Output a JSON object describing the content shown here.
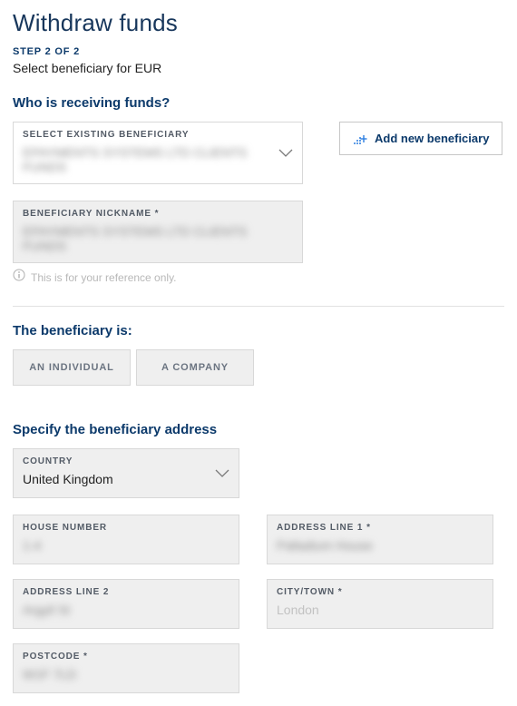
{
  "page": {
    "title": "Withdraw funds",
    "step": "STEP 2 OF 2",
    "subtitle": "Select beneficiary for EUR"
  },
  "receiving": {
    "heading": "Who is receiving funds?",
    "select_label": "SELECT EXISTING BENEFICIARY",
    "select_value_masked": "EPAYMENTS SYSTEMS LTD CLIENTS FUNDS",
    "add_button": "Add new beneficiary",
    "nickname_label": "BENEFICIARY NICKNAME *",
    "nickname_value_masked": "EPAYMENTS SYSTEMS LTD CLIENTS FUNDS",
    "helper": "This is for your reference only."
  },
  "beneficiary_type": {
    "heading": "The beneficiary is:",
    "individual": "AN INDIVIDUAL",
    "company": "A COMPANY"
  },
  "address": {
    "heading": "Specify the beneficiary address",
    "country_label": "COUNTRY",
    "country_value": "United Kingdom",
    "house_label": "HOUSE NUMBER",
    "house_value_masked": "1-4",
    "line1_label": "ADDRESS LINE 1 *",
    "line1_value_masked": "Palladium House",
    "line2_label": "ADDRESS LINE 2",
    "line2_value_masked": "Argyll St",
    "city_label": "CITY/TOWN *",
    "city_value": "London",
    "postcode_label": "POSTCODE *",
    "postcode_value_masked": "W1F 7LD"
  }
}
